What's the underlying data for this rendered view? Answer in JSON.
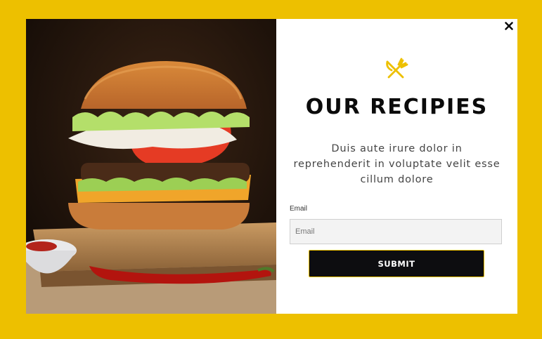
{
  "modal": {
    "close_icon": "close-icon",
    "logo_icon": "fork-knife-icon",
    "title": "OUR RECIPIES",
    "description": "Duis aute irure dolor in reprehenderit in voluptate velit esse cillum dolore",
    "email_label": "Email",
    "email_placeholder": "Email",
    "email_value": "",
    "submit_label": "SUBMIT"
  },
  "colors": {
    "background": "#EDC000",
    "accent": "#EDC000",
    "button_bg": "#0D0D10",
    "title": "#0B0B0B"
  }
}
